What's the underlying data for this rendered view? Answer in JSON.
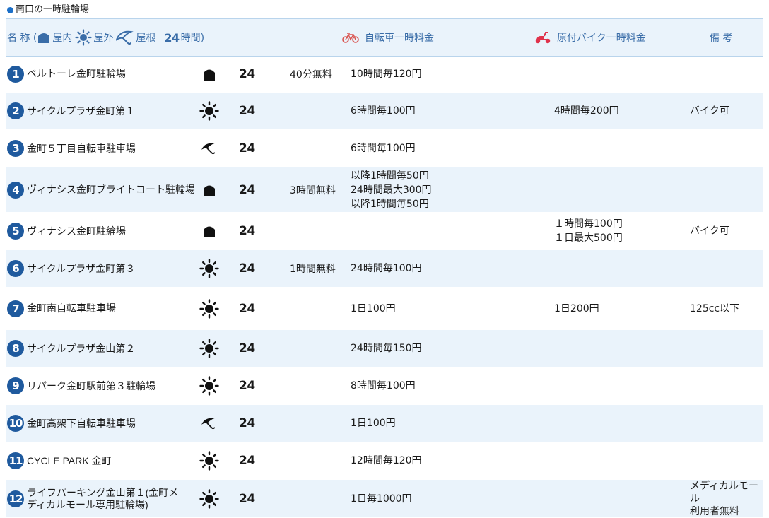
{
  "section_title": "南口の一時駐輪場",
  "header": {
    "name_prefix": "名 称 (",
    "indoor": "屋内",
    "outdoor": "屋外",
    "roof": "屋根",
    "hours24": "24",
    "hours_suffix": "時間)",
    "bicycle_fee": "自転車一時料金",
    "moto_fee": "原付バイク一時料金",
    "notes": "備 考"
  },
  "colors": {
    "accent": "#1f5a9e",
    "header_text": "#3a6da8",
    "row_shade": "#eaf3fb",
    "moto_icon": "#e0324b",
    "bike_icon": "#d9534f"
  },
  "rows": [
    {
      "no": "1",
      "name": "ベルトーレ金町駐輪場",
      "type": "indoor",
      "hours": "24",
      "free": "40分無料",
      "bicycle": "10時間毎120円",
      "moto": "",
      "note": ""
    },
    {
      "no": "2",
      "name": "サイクルプラザ金町第１",
      "type": "outdoor",
      "hours": "24",
      "free": "",
      "bicycle": "6時間毎100円",
      "moto": "4時間毎200円",
      "note": "バイク可"
    },
    {
      "no": "3",
      "name": "金町５丁目自転車駐車場",
      "type": "roof",
      "hours": "24",
      "free": "",
      "bicycle": "6時間毎100円",
      "moto": "",
      "note": ""
    },
    {
      "no": "4",
      "name": "ヴィナシス金町ブライトコート駐輪場",
      "type": "indoor",
      "hours": "24",
      "free": "3時間無料",
      "bicycle": "以降1時間毎50円\n24時間最大300円\n以降1時間毎50円",
      "moto": "",
      "note": ""
    },
    {
      "no": "5",
      "name": "ヴィナシス金町駐綸場",
      "type": "indoor",
      "hours": "24",
      "free": "",
      "bicycle": "",
      "moto": "１時間毎100円\n１日最大500円",
      "note": "バイク可"
    },
    {
      "no": "6",
      "name": "サイクルプラザ金町第３",
      "type": "outdoor",
      "hours": "24",
      "free": "1時間無料",
      "bicycle": "24時間毎100円",
      "moto": "",
      "note": ""
    },
    {
      "no": "7",
      "name": "金町南自転車駐車場",
      "type": "outdoor",
      "hours": "24",
      "free": "",
      "bicycle": "1日100円",
      "moto": "1日200円",
      "note": "125cc以下"
    },
    {
      "no": "8",
      "name": "サイクルプラザ金山第２",
      "type": "outdoor",
      "hours": "24",
      "free": "",
      "bicycle": "24時間毎150円",
      "moto": "",
      "note": ""
    },
    {
      "no": "9",
      "name": "リパーク金町駅前第３駐輪場",
      "type": "outdoor",
      "hours": "24",
      "free": "",
      "bicycle": "8時間毎100円",
      "moto": "",
      "note": ""
    },
    {
      "no": "10",
      "name": "金町高架下自転車駐車場",
      "type": "roof",
      "hours": "24",
      "free": "",
      "bicycle": "1日100円",
      "moto": "",
      "note": ""
    },
    {
      "no": "11",
      "name": "CYCLE PARK 金町",
      "type": "outdoor",
      "hours": "24",
      "free": "",
      "bicycle": "12時間毎120円",
      "moto": "",
      "note": ""
    },
    {
      "no": "12",
      "name": "ライフパーキング金山第１(金町メ\nディカルモール専用駐輪場)",
      "type": "outdoor",
      "hours": "24",
      "free": "",
      "bicycle": "1日毎1000円",
      "moto": "",
      "note": "メディカルモール\n利用者無料"
    }
  ]
}
